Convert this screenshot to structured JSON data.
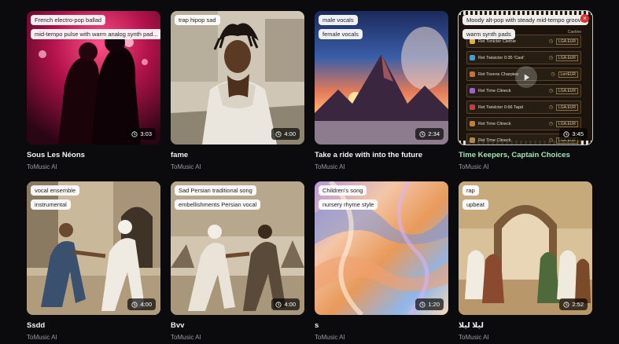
{
  "cards": [
    {
      "title": "Sous Les Néons",
      "author": "ToMusic AI",
      "duration": "3:03",
      "tags": [
        "French electro-pop ballad",
        "mid-tempo pulse with warm analog synth pad..."
      ]
    },
    {
      "title": "fame",
      "author": "ToMusic AI",
      "duration": "4:00",
      "tags": [
        "trap hipop sad"
      ]
    },
    {
      "title": "Take a ride with into the future",
      "author": "ToMusic AI",
      "duration": "2:34",
      "tags": [
        "male vocals",
        "female vocals"
      ]
    },
    {
      "title": "Time Keepers, Captain Choices",
      "author": "ToMusic AI",
      "duration": "3:45",
      "tags": [
        "Moody alt-pop with steady mid-tempo groove",
        "warm synth pads"
      ],
      "artwork_list": {
        "header": "Caetine",
        "rows": [
          {
            "name": "Ret Tonicter Clethie",
            "value": "LGA.EUR",
            "color": "#e0b040"
          },
          {
            "name": "Ret Twisicter 0:35 'Cast'",
            "value": "LGA.EUR",
            "color": "#3fa0d8"
          },
          {
            "name": "Ret Tovens Charpies",
            "value": "LerrEUR",
            "color": "#d07030"
          },
          {
            "name": "Ret Time Clineck",
            "value": "LGA.EUR",
            "color": "#a060d0"
          },
          {
            "name": "Ret Twislcter 0:66 Tapd",
            "value": "LGA.EUR",
            "color": "#c04040"
          },
          {
            "name": "Ret Time Clineck",
            "value": "LGA.EUR",
            "color": "#c08030"
          },
          {
            "name": "Ret Time Clineck",
            "value": "LGA.EUR",
            "color": "#b08a40"
          }
        ]
      }
    },
    {
      "title": "Ssdd",
      "author": "ToMusic AI",
      "duration": "4:00",
      "tags": [
        "vocal ensemble",
        "instrumental"
      ]
    },
    {
      "title": "Bvv",
      "author": "ToMusic AI",
      "duration": "4:00",
      "tags": [
        "Sad Persian traditional song",
        "embellishments Persian vocal"
      ]
    },
    {
      "title": "s",
      "author": "ToMusic AI",
      "duration": "1:20",
      "tags": [
        "Children's song",
        "nursery rhyme style"
      ]
    },
    {
      "title": "لیلا لیلا",
      "author": "ToMusic AI",
      "duration": "2:52",
      "tags": [
        "rap",
        "upbeat"
      ]
    }
  ],
  "colors": {
    "background": "#0b0b0d",
    "active_title": "#9fe6b9",
    "author": "#9a9aa0"
  },
  "icons": {
    "duration": "clock-icon",
    "play": "play-icon",
    "close": "close-icon"
  }
}
